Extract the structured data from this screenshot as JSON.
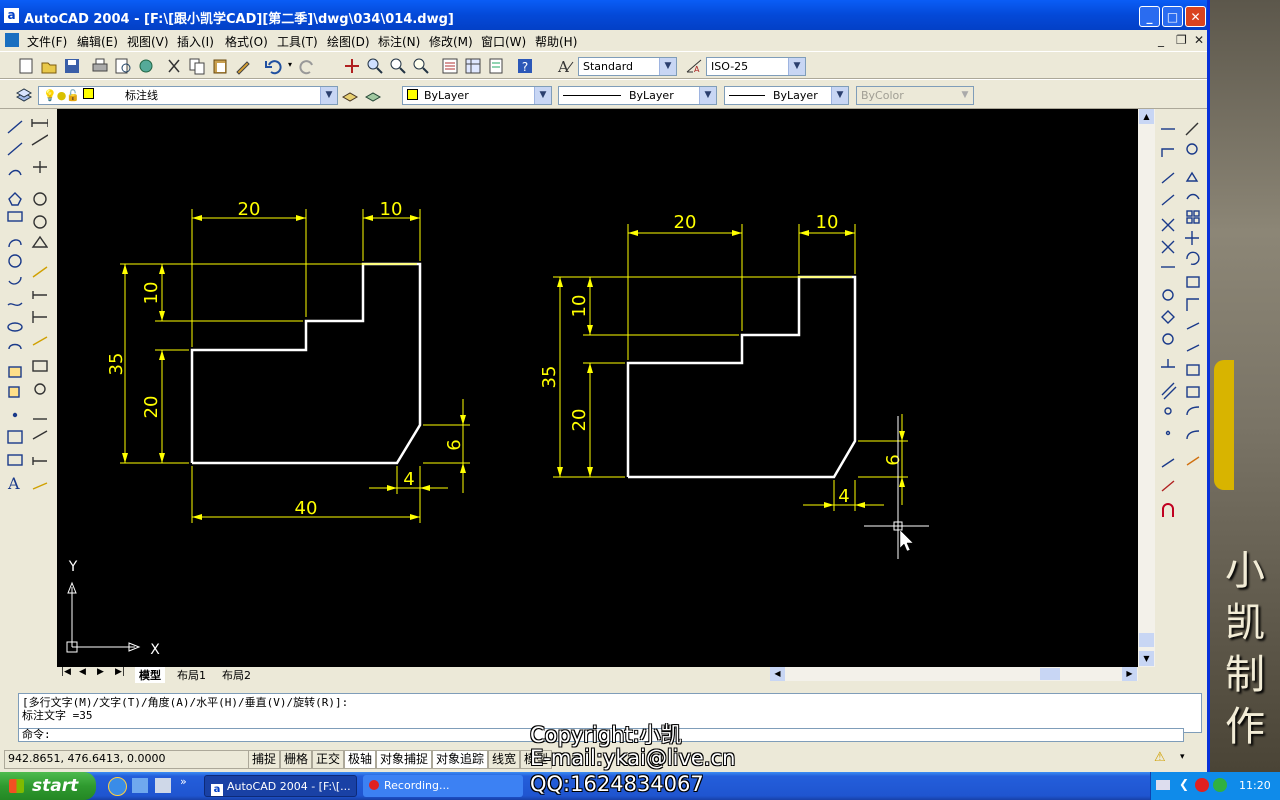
{
  "window": {
    "title": "AutoCAD 2004 - [F:\\[跟小凯学CAD][第二季]\\dwg\\034\\014.dwg]",
    "app_icon": "a"
  },
  "menu": [
    "文件(F)",
    "编辑(E)",
    "视图(V)",
    "插入(I)",
    "格式(O)",
    "工具(T)",
    "绘图(D)",
    "标注(N)",
    "修改(M)",
    "窗口(W)",
    "帮助(H)"
  ],
  "toolbar": {
    "text_style": "Standard",
    "dim_style": "ISO-25",
    "layer": "标注线",
    "color": "ByLayer",
    "linetype": "ByLayer",
    "lineweight": "ByLayer",
    "plotstyle": "ByColor"
  },
  "drawing": {
    "left_part": {
      "dims": [
        "20",
        "10",
        "10",
        "35",
        "20",
        "6",
        "4",
        "40"
      ]
    },
    "right_part": {
      "dims": [
        "20",
        "10",
        "10",
        "35",
        "20",
        "6",
        "4"
      ]
    },
    "ucs": {
      "x": "X",
      "y": "Y"
    }
  },
  "tabs": [
    "模型",
    "布局1",
    "布局2"
  ],
  "command": {
    "line1": "[多行文字(M)/文字(T)/角度(A)/水平(H)/垂直(V)/旋转(R)]:",
    "line2": "标注文字 =35",
    "prompt": "命令:"
  },
  "status": {
    "coords": "942.8651, 476.6413, 0.0000",
    "toggles": [
      "捕捉",
      "栅格",
      "正交",
      "极轴",
      "对象捕捉",
      "对象追踪",
      "线宽",
      "模型"
    ]
  },
  "overlay": {
    "copyright": "Copyright:小凯",
    "email": "E-mail:ykai@live.cn",
    "qq": "QQ:1624834067",
    "brand": "小凯制作"
  },
  "taskbar": {
    "start": "start",
    "tasks": [
      "AutoCAD 2004 - [F:\\[...",
      "Recording..."
    ],
    "time": "11:20"
  },
  "colors": {
    "canvas": "#000000",
    "object_lines": "#ffffff",
    "dimensions": "#ffff00",
    "titlebar": "#0449d8"
  }
}
